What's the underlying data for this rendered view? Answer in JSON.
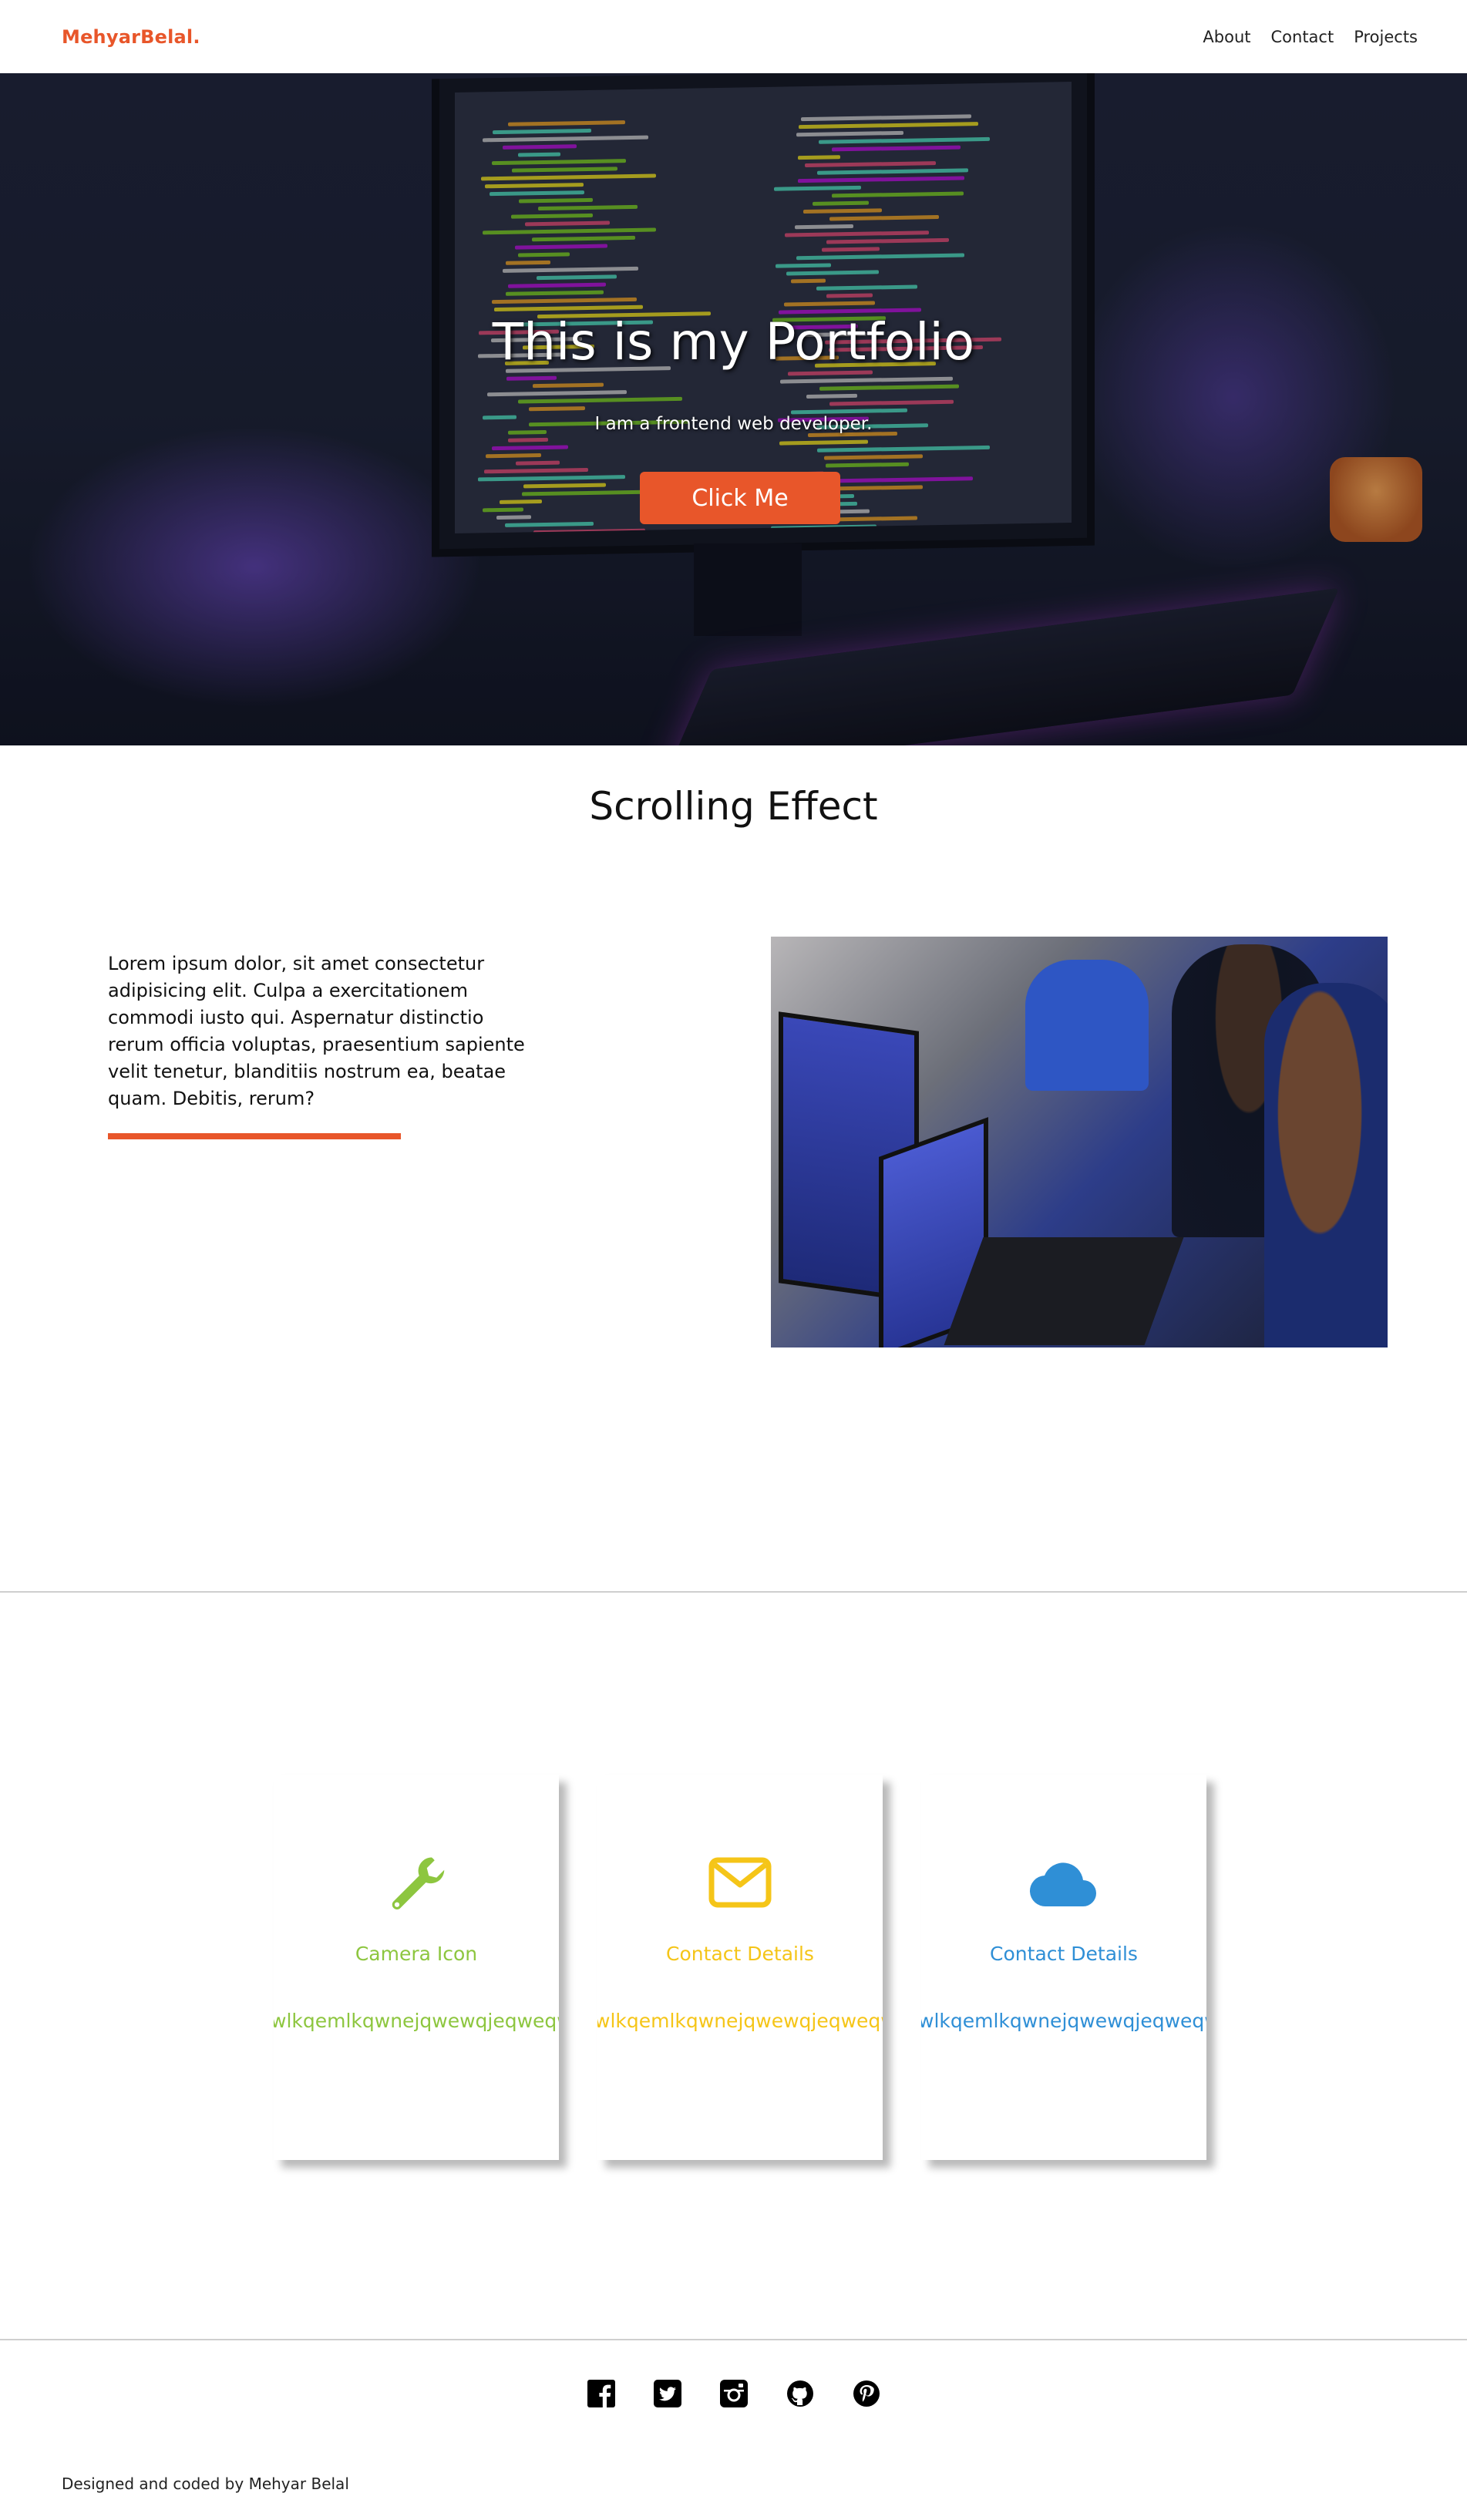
{
  "nav": {
    "brand": "MehyarBelal.",
    "links": [
      "About",
      "Contact",
      "Projects"
    ]
  },
  "hero": {
    "title": "This is my Portfolio",
    "subtitle": "I am a frontend web developer.",
    "button": "Click Me"
  },
  "section": {
    "title": "Scrolling Effect",
    "paragraph": "Lorem ipsum dolor, sit amet consectetur adipisicing elit. Culpa a exercitationem commodi iusto qui. Aspernatur distinctio rerum officia voluptas, praesentium sapiente velit tenetur, blanditiis nostrum ea, beatae quam. Debitis, rerum?"
  },
  "cards": [
    {
      "icon": "wrench-icon",
      "title": "Camera Icon",
      "text": "wlkqemlkqwnejqwewqjeqweqw",
      "color": "#8dc63f"
    },
    {
      "icon": "envelope-icon",
      "title": "Contact Details",
      "text": "wlkqemlkqwnejqwewqjeqweqw",
      "color": "#f5c518"
    },
    {
      "icon": "cloud-icon",
      "title": "Contact Details",
      "text": "wlkqemlkqwnejqwewqjeqweqw",
      "color": "#2f8fd6"
    }
  ],
  "footer": {
    "socials": [
      "facebook-icon",
      "twitter-icon",
      "instagram-icon",
      "github-icon",
      "pinterest-icon"
    ],
    "credit": "Designed and coded by Mehyar Belal"
  },
  "colors": {
    "accent": "#e8562a"
  }
}
